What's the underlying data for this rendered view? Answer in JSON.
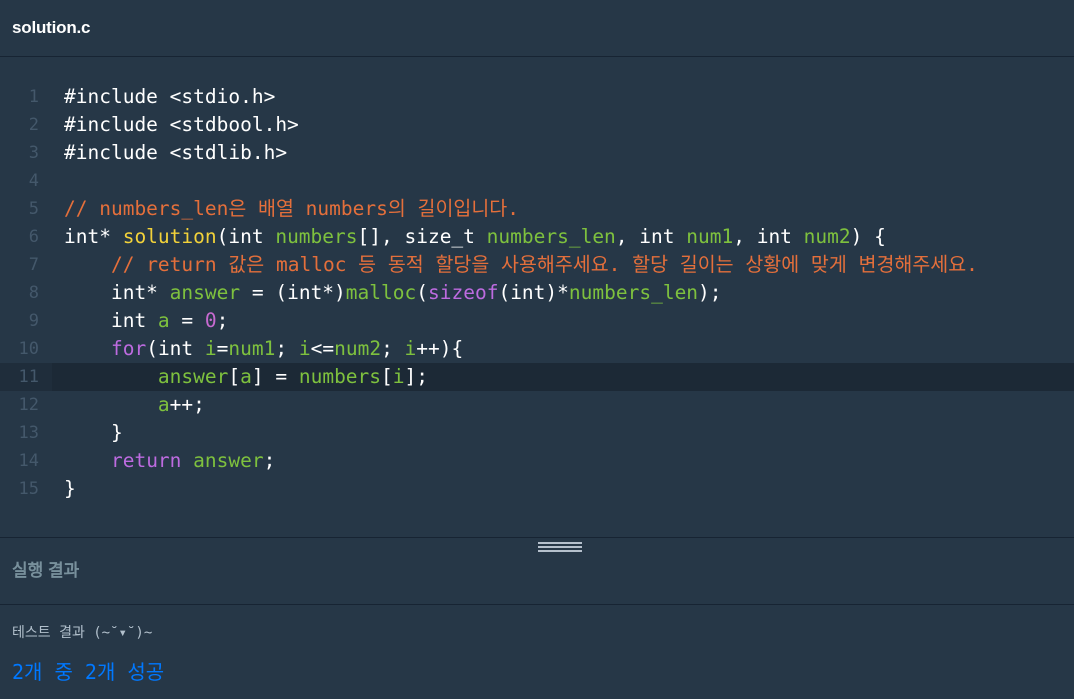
{
  "tab": {
    "title": "solution.c"
  },
  "editor": {
    "active_line": 11,
    "lines": [
      {
        "n": "1",
        "t": [
          [
            "pl",
            "#include <stdio.h>"
          ]
        ]
      },
      {
        "n": "2",
        "t": [
          [
            "pl",
            "#include <stdbool.h>"
          ]
        ]
      },
      {
        "n": "3",
        "t": [
          [
            "pl",
            "#include <stdlib.h>"
          ]
        ]
      },
      {
        "n": "4",
        "t": []
      },
      {
        "n": "5",
        "t": [
          [
            "cm",
            "// numbers_len은 배열 numbers의 길이입니다."
          ]
        ]
      },
      {
        "n": "6",
        "t": [
          [
            "pl",
            "int* "
          ],
          [
            "fn",
            "solution"
          ],
          [
            "pl",
            "(int "
          ],
          [
            "id",
            "numbers"
          ],
          [
            "pl",
            "[], size_t "
          ],
          [
            "id",
            "numbers_len"
          ],
          [
            "pl",
            ", int "
          ],
          [
            "id",
            "num1"
          ],
          [
            "pl",
            ", int "
          ],
          [
            "id",
            "num2"
          ],
          [
            "pl",
            ") {"
          ]
        ]
      },
      {
        "n": "7",
        "t": [
          [
            "pl",
            "    "
          ],
          [
            "cm",
            "// return 값은 malloc 등 동적 할당을 사용해주세요. 할당 길이는 상황에 맞게 변경해주세요."
          ]
        ]
      },
      {
        "n": "8",
        "t": [
          [
            "pl",
            "    int* "
          ],
          [
            "id",
            "answer"
          ],
          [
            "pl",
            " = (int*)"
          ],
          [
            "id",
            "malloc"
          ],
          [
            "pl",
            "("
          ],
          [
            "kw",
            "sizeof"
          ],
          [
            "pl",
            "(int)*"
          ],
          [
            "id",
            "numbers_len"
          ],
          [
            "pl",
            ");"
          ]
        ]
      },
      {
        "n": "9",
        "t": [
          [
            "pl",
            "    int "
          ],
          [
            "id",
            "a"
          ],
          [
            "pl",
            " = "
          ],
          [
            "num",
            "0"
          ],
          [
            "pl",
            ";"
          ]
        ]
      },
      {
        "n": "10",
        "t": [
          [
            "pl",
            "    "
          ],
          [
            "kw",
            "for"
          ],
          [
            "pl",
            "(int "
          ],
          [
            "id",
            "i"
          ],
          [
            "pl",
            "="
          ],
          [
            "id",
            "num1"
          ],
          [
            "pl",
            "; "
          ],
          [
            "id",
            "i"
          ],
          [
            "pl",
            "<="
          ],
          [
            "id",
            "num2"
          ],
          [
            "pl",
            "; "
          ],
          [
            "id",
            "i"
          ],
          [
            "pl",
            "++){"
          ]
        ]
      },
      {
        "n": "11",
        "t": [
          [
            "pl",
            "        "
          ],
          [
            "id",
            "answer"
          ],
          [
            "pl",
            "["
          ],
          [
            "id",
            "a"
          ],
          [
            "pl",
            "] = "
          ],
          [
            "id",
            "numbers"
          ],
          [
            "pl",
            "["
          ],
          [
            "id",
            "i"
          ],
          [
            "pl",
            "];"
          ]
        ]
      },
      {
        "n": "12",
        "t": [
          [
            "pl",
            "        "
          ],
          [
            "id",
            "a"
          ],
          [
            "pl",
            "++;"
          ]
        ]
      },
      {
        "n": "13",
        "t": [
          [
            "pl",
            "    }"
          ]
        ]
      },
      {
        "n": "14",
        "t": [
          [
            "pl",
            "    "
          ],
          [
            "kw",
            "return"
          ],
          [
            "pl",
            " "
          ],
          [
            "id",
            "answer"
          ],
          [
            "pl",
            ";"
          ]
        ]
      },
      {
        "n": "15",
        "t": [
          [
            "pl",
            "}"
          ]
        ]
      }
    ]
  },
  "results": {
    "header": "실행 결과",
    "label": "테스트 결과 (~˘▾˘)~",
    "summary": "2개 중 2개 성공"
  },
  "colors": {
    "background": "#263747",
    "comment": "#e46f3b",
    "function_name": "#f2d23a",
    "identifier": "#7ec13e",
    "keyword": "#bd6be0",
    "success": "#0078ff"
  }
}
